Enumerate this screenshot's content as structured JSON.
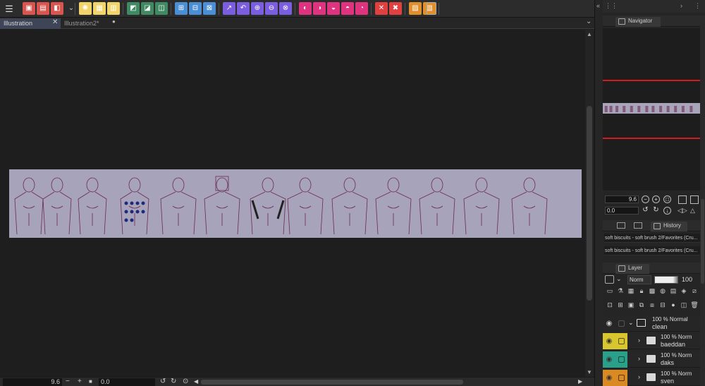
{
  "tabs": [
    {
      "label": "Illustration",
      "active": true,
      "close": "✕"
    },
    {
      "label": "Illustration2*",
      "active": false,
      "close": "●"
    }
  ],
  "toolbar": {
    "menu_icon": "hamburger-menu-icon",
    "groups": [
      {
        "color": "#d9544f",
        "count": 3
      },
      {
        "color": "#f2d56a",
        "count": 3
      },
      {
        "color": "#3f8a62",
        "count": 3
      },
      {
        "color": "#4a8fd6",
        "count": 3
      },
      {
        "color": "#7b5de0",
        "count": 5
      },
      {
        "color": "#e0337f",
        "count": 5
      },
      {
        "color": "#e04040",
        "count": 2
      },
      {
        "color": "#e08f2a",
        "count": 2
      }
    ],
    "last_icon": "device-icon"
  },
  "status_bar": {
    "zoom": "9.6",
    "minus": "−",
    "plus": "+",
    "angle": "0.0"
  },
  "navigator": {
    "title": "Navigator",
    "zoom": "9.6",
    "angle": "0.0"
  },
  "history": {
    "tab_icons": [
      "material-icon",
      "sub-tool-icon"
    ],
    "title": "History",
    "items": [
      "soft biscuits - soft brush 2/Favorites (Cru...",
      "soft biscuits - soft brush 2/Favorites (Cru..."
    ]
  },
  "layer_panel": {
    "title": "Layer",
    "blend_mode": "Norm",
    "opacity": "100",
    "layers": [
      {
        "line1": "100 % Normal",
        "line2": "clean",
        "color": "#262626",
        "lock_color": "#555",
        "expanded": true
      },
      {
        "line1": "100 % Norm",
        "line2": "baeddan",
        "color": "#d8c62e",
        "lock_color": "#5a4e00",
        "expanded": false
      },
      {
        "line1": "100 % Norm",
        "line2": "daks",
        "color": "#2aa08a",
        "lock_color": "#0d4a3c",
        "expanded": false
      },
      {
        "line1": "100 % Norm",
        "line2": "sven",
        "color": "#d98a22",
        "lock_color": "#5c3400",
        "expanded": false
      }
    ]
  },
  "colors": {
    "accent_tab": "#3d4556",
    "canvas_paper": "#a7a3ba",
    "sketch_line": "#6b2a52"
  }
}
